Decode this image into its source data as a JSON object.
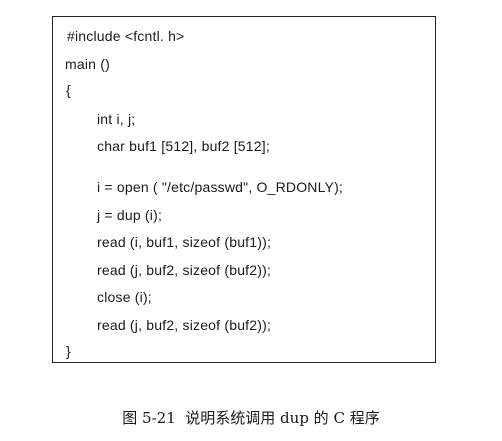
{
  "code_lines": [
    "#include <fcntl. h>",
    "main ()",
    "{",
    "int i, j;",
    "char buf1 [512], buf2 [512];",
    "i = open ( \"/etc/passwd\", O_RDONLY);",
    "j = dup (i);",
    "read (i, buf1, sizeof (buf1));",
    "read (j, buf2, sizeof (buf2));",
    "close (i);",
    "read (j, buf2, sizeof (buf2));",
    "}"
  ],
  "caption": "图 5-21  说明系统调用 dup 的 C 程序"
}
